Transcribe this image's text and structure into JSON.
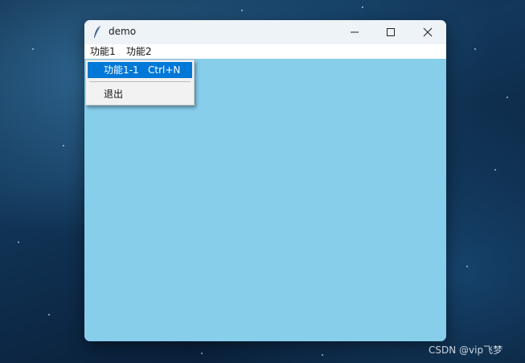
{
  "window": {
    "title": "demo",
    "content_color": "#87ceeb"
  },
  "titlebar": {
    "app_icon": "feather-icon",
    "minimize_icon": "minimize-icon",
    "maximize_icon": "maximize-icon",
    "close_icon": "close-icon"
  },
  "menubar": {
    "items": [
      {
        "label": "功能1"
      },
      {
        "label": "功能2"
      }
    ]
  },
  "dropdown": {
    "items": [
      {
        "label": "功能1-1",
        "accelerator": "Ctrl+N",
        "highlighted": true
      },
      {
        "label": "退出"
      }
    ],
    "highlight_color": "#0078d7"
  },
  "watermark": {
    "text": "CSDN @vip飞梦"
  }
}
